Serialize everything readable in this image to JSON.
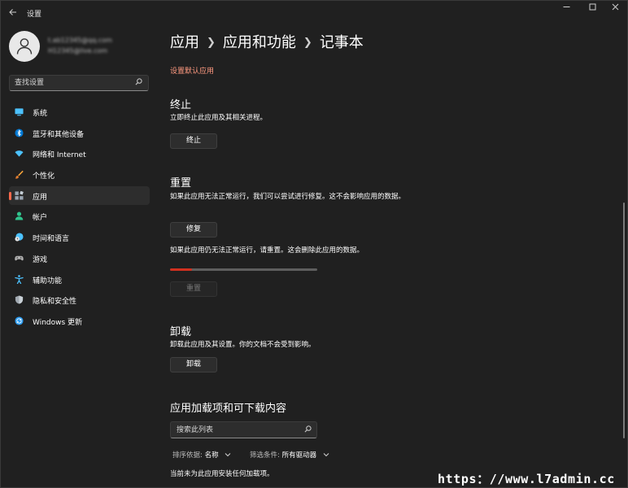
{
  "window": {
    "title": "设置",
    "controls": [
      "minimize",
      "maximize",
      "close"
    ]
  },
  "account": {
    "name": "t.ab12345@qq.com",
    "email": "H12345@live.com"
  },
  "sidebar": {
    "search_placeholder": "查找设置",
    "items": [
      {
        "label": "系统",
        "icon": "system-icon",
        "color": "#4cc2ff"
      },
      {
        "label": "蓝牙和其他设备",
        "icon": "bluetooth-icon",
        "color": "#0078d4"
      },
      {
        "label": "网络和 Internet",
        "icon": "network-icon",
        "color": "#4cc2ff"
      },
      {
        "label": "个性化",
        "icon": "brush-icon",
        "color": "#f7a33a"
      },
      {
        "label": "应用",
        "icon": "apps-icon",
        "color": "#9aa6b2",
        "selected": true
      },
      {
        "label": "帐户",
        "icon": "account-icon",
        "color": "#30c48d"
      },
      {
        "label": "时间和语言",
        "icon": "time-language-icon",
        "color": "#4cc2ff"
      },
      {
        "label": "游戏",
        "icon": "gamepad-icon",
        "color": "#b0b0b0"
      },
      {
        "label": "辅助功能",
        "icon": "accessibility-icon",
        "color": "#4cc2ff"
      },
      {
        "label": "隐私和安全性",
        "icon": "shield-icon",
        "color": "#a0a8b0"
      },
      {
        "label": "Windows 更新",
        "icon": "update-icon",
        "color": "#2b9cf2"
      }
    ]
  },
  "breadcrumb": [
    "应用",
    "应用和功能",
    "记事本"
  ],
  "main": {
    "default_apps_link": "设置默认应用",
    "terminate": {
      "title": "终止",
      "description": "立即终止此应用及其相关进程。",
      "button": "终止"
    },
    "reset": {
      "title": "重置",
      "repair_description": "如果此应用无法正常运行，我们可以尝试进行修复。这不会影响应用的数据。",
      "repair_button": "修复",
      "reset_description": "如果此应用仍无法正常运行，请重置。这会删除此应用的数据。",
      "progress": 0.15,
      "reset_button": "重置"
    },
    "uninstall": {
      "title": "卸载",
      "description": "卸载此应用及其设置。你的文档不会受到影响。",
      "button": "卸载"
    },
    "addons": {
      "title": "应用加载项和可下载内容",
      "search_placeholder": "搜索此列表",
      "sort_label": "排序依据:",
      "sort_value": "名称",
      "filter_label": "筛选条件:",
      "filter_value": "所有驱动器",
      "empty_message": "当前未为此应用安装任何加载项。"
    }
  },
  "colors": {
    "accent": "#ff6a4d",
    "link": "#ff9a80",
    "progress": "#d1301f",
    "background": "#202020"
  },
  "watermark": "https：//www.l7admin.cc"
}
